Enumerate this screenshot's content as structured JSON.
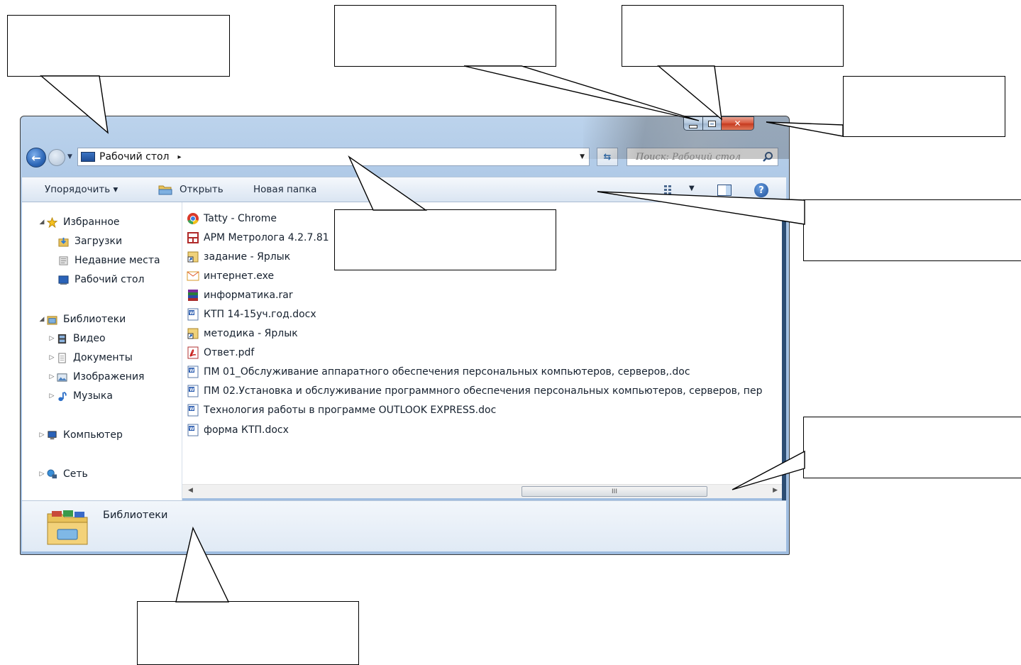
{
  "window": {
    "address": {
      "location": "Рабочий стол",
      "separator": "▸"
    },
    "search": {
      "placeholder": "Поиск: Рабочий стол"
    },
    "toolbar": {
      "organize": "Упорядочить ▾",
      "open": "Открыть",
      "new_folder": "Новая папка"
    },
    "nav": {
      "favorites": "Избранное",
      "downloads": "Загрузки",
      "recent": "Недавние места",
      "desktop": "Рабочий стол",
      "libraries": "Библиотеки",
      "video": "Видео",
      "documents": "Документы",
      "pictures": "Изображения",
      "music": "Музыка",
      "computer": "Компьютер",
      "network": "Сеть"
    },
    "files": [
      {
        "name": "Tatty - Chrome",
        "icon": "chrome-app-icon"
      },
      {
        "name": "АРМ Метролога 4.2.7.81",
        "icon": "arm-app-icon"
      },
      {
        "name": "задание - Ярлык",
        "icon": "shortcut-icon"
      },
      {
        "name": "интернет.exe",
        "icon": "exe-icon"
      },
      {
        "name": "информатика.rar",
        "icon": "rar-archive-icon"
      },
      {
        "name": "КТП 14-15уч.год.docx",
        "icon": "word-doc-icon"
      },
      {
        "name": "методика - Ярлык",
        "icon": "shortcut-icon"
      },
      {
        "name": "Ответ.pdf",
        "icon": "pdf-icon"
      },
      {
        "name": "ПМ 01_Обслуживание аппаратного обеспечения персональных компьютеров, серверов,.doc",
        "icon": "word-doc-icon"
      },
      {
        "name": "ПМ 02.Установка и обслуживание программного обеспечения персональных компьютеров, серверов, пер",
        "icon": "word-doc-icon"
      },
      {
        "name": "Технология работы в программе OUTLOOK EXPRESS.doc",
        "icon": "word-doc-icon"
      },
      {
        "name": "форма КТП.docx",
        "icon": "word-doc-icon"
      }
    ],
    "scrollbar_grip": "III",
    "details": {
      "selected": "Библиотеки"
    },
    "colors": {
      "close_button": "#c53a1f",
      "selection": "#cfe2f6",
      "frame": "#a8c4e4"
    }
  }
}
